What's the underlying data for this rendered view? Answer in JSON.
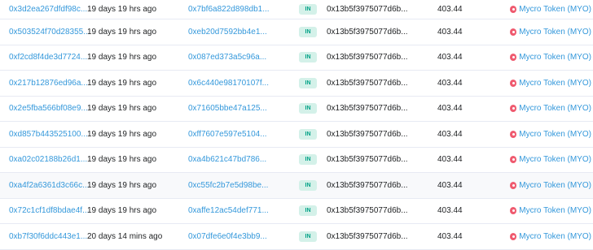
{
  "rows": [
    {
      "hash": "0x3d2ea267dfdf98c...",
      "age": "19 days 19 hrs ago",
      "from": "0x7bf6a822d898db1...",
      "direction": "IN",
      "to": "0x13b5f3975077d6b...",
      "amount": "403.44",
      "token": "Mycro Token (MYO)"
    },
    {
      "hash": "0x503524f70d28355...",
      "age": "19 days 19 hrs ago",
      "from": "0xeb20d7592bb4e1...",
      "direction": "IN",
      "to": "0x13b5f3975077d6b...",
      "amount": "403.44",
      "token": "Mycro Token (MYO)"
    },
    {
      "hash": "0xf2cd8f4de3d7724...",
      "age": "19 days 19 hrs ago",
      "from": "0x087ed373a5c96a...",
      "direction": "IN",
      "to": "0x13b5f3975077d6b...",
      "amount": "403.44",
      "token": "Mycro Token (MYO)"
    },
    {
      "hash": "0x217b12876ed96a...",
      "age": "19 days 19 hrs ago",
      "from": "0x6c440e98170107f...",
      "direction": "IN",
      "to": "0x13b5f3975077d6b...",
      "amount": "403.44",
      "token": "Mycro Token (MYO)"
    },
    {
      "hash": "0x2e5fba566bf08e9...",
      "age": "19 days 19 hrs ago",
      "from": "0x71605bbe47a125...",
      "direction": "IN",
      "to": "0x13b5f3975077d6b...",
      "amount": "403.44",
      "token": "Mycro Token (MYO)"
    },
    {
      "hash": "0xd857b443525100...",
      "age": "19 days 19 hrs ago",
      "from": "0xff7607e597e5104...",
      "direction": "IN",
      "to": "0x13b5f3975077d6b...",
      "amount": "403.44",
      "token": "Mycro Token (MYO)"
    },
    {
      "hash": "0xa02c02188b26d1...",
      "age": "19 days 19 hrs ago",
      "from": "0xa4b621c47bd786...",
      "direction": "IN",
      "to": "0x13b5f3975077d6b...",
      "amount": "403.44",
      "token": "Mycro Token (MYO)"
    },
    {
      "hash": "0xa4f2a6361d3c66c...",
      "age": "19 days 19 hrs ago",
      "from": "0xc55fc2b7e5d98be...",
      "direction": "IN",
      "to": "0x13b5f3975077d6b...",
      "amount": "403.44",
      "token": "Mycro Token (MYO)"
    },
    {
      "hash": "0x72c1cf1df8bdae4f...",
      "age": "19 days 19 hrs ago",
      "from": "0xaffe12ac54def771...",
      "direction": "IN",
      "to": "0x13b5f3975077d6b...",
      "amount": "403.44",
      "token": "Mycro Token (MYO)"
    },
    {
      "hash": "0xb7f30f6ddc443e1...",
      "age": "20 days 14 mins ago",
      "from": "0x07dfe6e0f4e3bb9...",
      "direction": "IN",
      "to": "0x13b5f3975077d6b...",
      "amount": "403.44",
      "token": "Mycro Token (MYO)"
    }
  ],
  "colors": {
    "link": "#3498db",
    "badge_bg": "#d4f1e9",
    "badge_text": "#00a186",
    "token_icon": "#ef5a6f"
  },
  "icons": {
    "token": "mycro-token-icon"
  }
}
